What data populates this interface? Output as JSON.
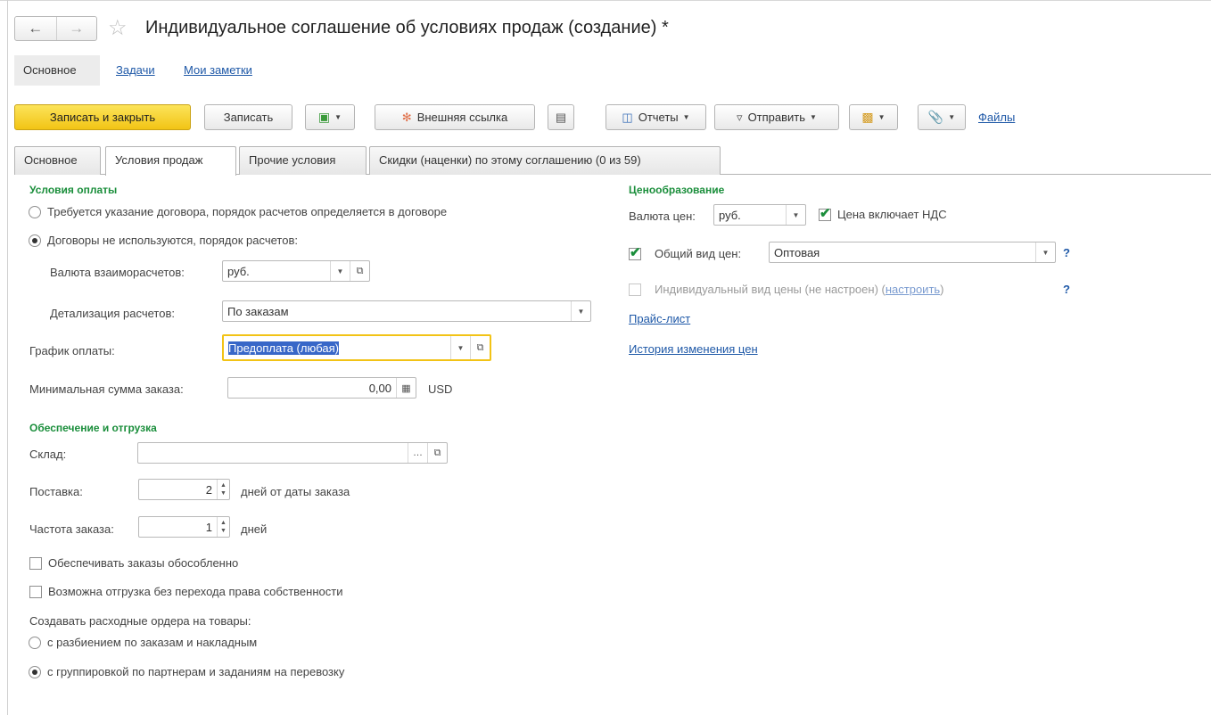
{
  "window": {
    "title": "Индивидуальное соглашение об условиях продаж (создание) *"
  },
  "nav_panel": {
    "items": [
      "Основное",
      "Задачи",
      "Мои заметки"
    ]
  },
  "toolbar": {
    "save_close": "Записать и закрыть",
    "save": "Записать",
    "external_link": "Внешняя ссылка",
    "reports": "Отчеты",
    "send": "Отправить",
    "files": "Файлы"
  },
  "tabs": [
    "Основное",
    "Условия продаж",
    "Прочие условия",
    "Скидки (наценки) по этому соглашению (0 из 59)"
  ],
  "active_tab": "Условия продаж",
  "payment": {
    "section": "Условия оплаты",
    "radio1": "Требуется указание договора, порядок расчетов определяется в договоре",
    "radio2": "Договоры не используются, порядок расчетов:",
    "selected": "radio2",
    "currency_label": "Валюта взаиморасчетов:",
    "currency_value": "руб.",
    "detail_label": "Детализация расчетов:",
    "detail_value": "По заказам",
    "schedule_label": "График оплаты:",
    "schedule_value": "Предоплата (любая)",
    "min_sum_label": "Минимальная сумма заказа:",
    "min_sum_value": "0,00",
    "min_sum_currency": "USD"
  },
  "shipping": {
    "section": "Обеспечение и отгрузка",
    "warehouse_label": "Склад:",
    "warehouse_value": "",
    "delivery_label": "Поставка:",
    "delivery_value": "2",
    "delivery_suffix": "дней от даты заказа",
    "frequency_label": "Частота заказа:",
    "frequency_value": "1",
    "frequency_suffix": "дней",
    "check1": "Обеспечивать заказы обособленно",
    "check2": "Возможна отгрузка без перехода права собственности",
    "orders_label": "Создавать расходные ордера на товары:",
    "orders_radio1": "с разбиением по заказам и накладным",
    "orders_radio2": "с группировкой по партнерам и заданиям на перевозку",
    "orders_selected": "orders_radio2"
  },
  "pricing": {
    "section": "Ценообразование",
    "currency_label": "Валюта цен:",
    "currency_value": "руб.",
    "vat_label": "Цена включает НДС",
    "vat_checked": true,
    "general_label": "Общий вид цен:",
    "general_checked": true,
    "general_value": "Оптовая",
    "individual_label": "Индивидуальный вид цены (не настроен) (",
    "individual_link": "настроить",
    "individual_close": ")",
    "individual_checked": false,
    "help": "?",
    "price_list": "Прайс-лист",
    "history": "История изменения цен"
  }
}
